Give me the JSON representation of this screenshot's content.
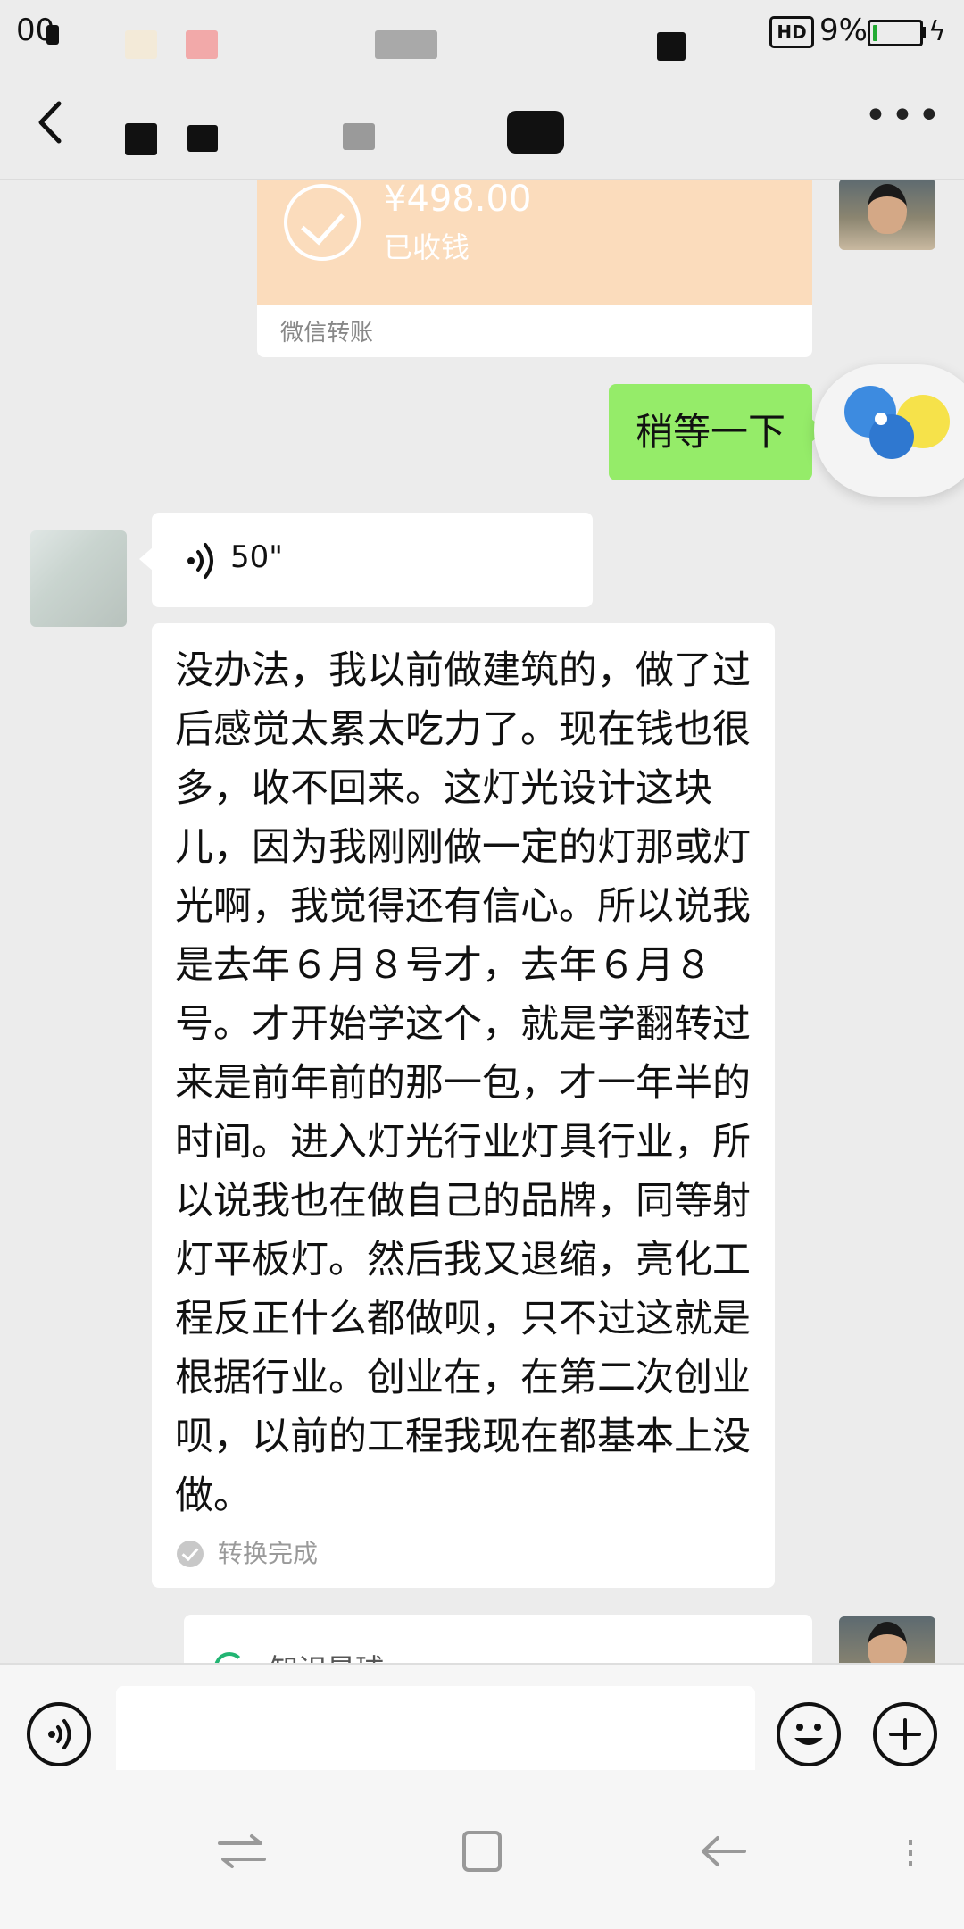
{
  "status_bar": {
    "time": "00",
    "hd_badge": "HD",
    "battery_percent": "9%",
    "battery_level": 0.09,
    "battery_color": "#22aa33"
  },
  "nav": {
    "back_icon": "chevron-left-icon",
    "more_icon": "more-dots-icon",
    "more_label": "•••"
  },
  "messages": {
    "transfer": {
      "amount": "¥498.00",
      "status": "已收钱",
      "footer": "微信转账",
      "color": "#fbdcbc"
    },
    "sent_text": "稍等一下",
    "voice": {
      "duration": "50\""
    },
    "converted_text": "没办法，我以前做建筑的，做了过后感觉太累太吃力了。现在钱也很多，收不回来。这灯光设计这块儿，因为我刚刚做一定的灯那或灯光啊，我觉得还有信心。所以说我是去年６月８号才，去年６月８号。才开始学这个，就是学翻转过来是前年前的那一包，才一年半的时间。进入灯光行业灯具行业，所以说我也在做自己的品牌，同等射灯平板灯。然后我又退缩，亮化工程反正什么都做呗，只不过这就是根据行业。创业在，在第二次创业呗，以前的工程我现在都基本上没做。",
    "conversion_status": "转换完成",
    "link_card_title": "知识星球"
  },
  "input_bar": {
    "voice_icon": "voice-icon",
    "emoji_icon": "emoji-icon",
    "plus_icon": "plus-icon"
  },
  "colors": {
    "bubble_green": "#95ec69",
    "background": "#ececec"
  }
}
